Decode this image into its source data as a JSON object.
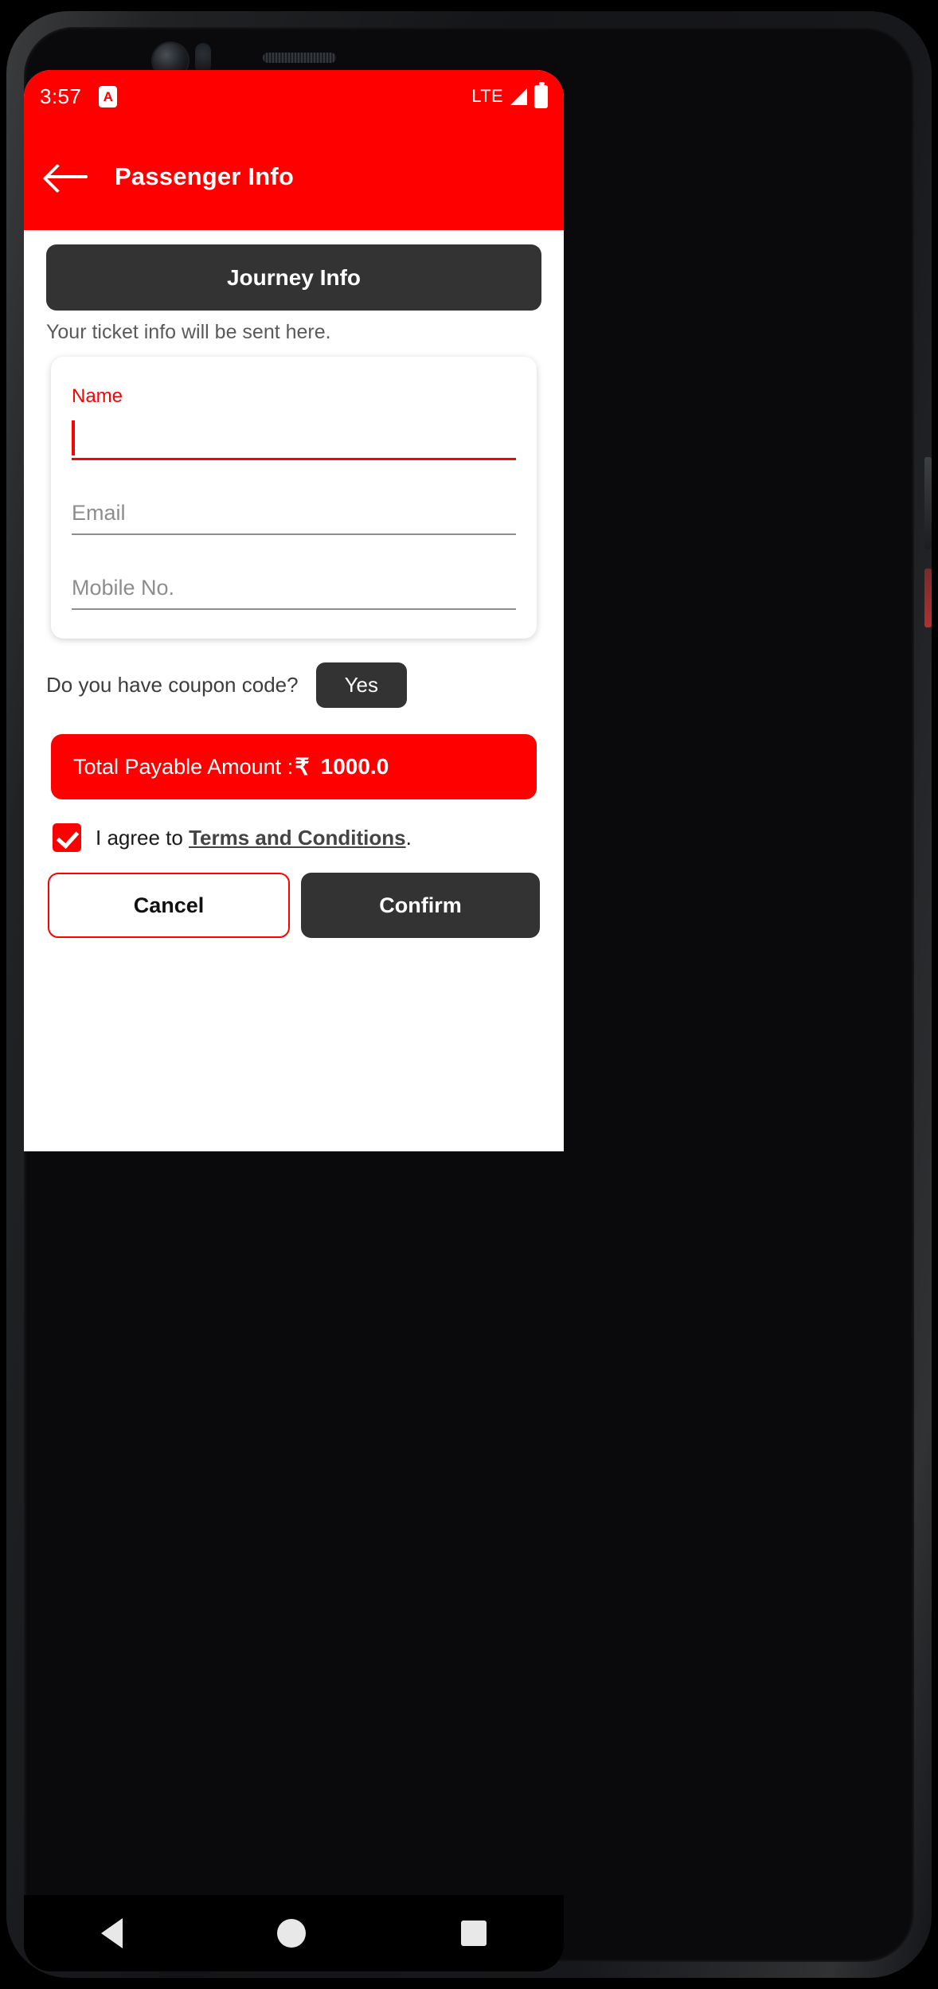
{
  "status_bar": {
    "time": "3:57",
    "app_badge": "A",
    "network": "LTE",
    "signal_icon": "signal-triangle-icon",
    "battery_icon": "battery-icon"
  },
  "app_bar": {
    "back_icon": "back-arrow-icon",
    "title": "Passenger Info"
  },
  "journey": {
    "button_label": "Journey Info"
  },
  "subtitle": "Your ticket info will be sent here.",
  "form": {
    "fields": [
      {
        "label": "Name",
        "value": "",
        "state": "focused"
      },
      {
        "placeholder": "Email",
        "value": "",
        "state": "idle"
      },
      {
        "placeholder": "Mobile No.",
        "value": "",
        "state": "idle"
      }
    ]
  },
  "coupon": {
    "question": "Do you have coupon code?",
    "yes_label": "Yes"
  },
  "total": {
    "label": "Total Payable Amount :",
    "currency": "₹",
    "amount": "1000.0"
  },
  "terms": {
    "checked": true,
    "prefix": "I agree to ",
    "link": "Terms and Conditions",
    "suffix": "."
  },
  "actions": {
    "cancel": "Cancel",
    "confirm": "Confirm"
  },
  "nav_bar": {
    "back": "nav-back-icon",
    "home": "nav-home-icon",
    "recent": "nav-recent-icon"
  },
  "colors": {
    "brand_red": "#FF0000",
    "dark_button": "#333333",
    "placeholder_gray": "#8D8D8D"
  }
}
